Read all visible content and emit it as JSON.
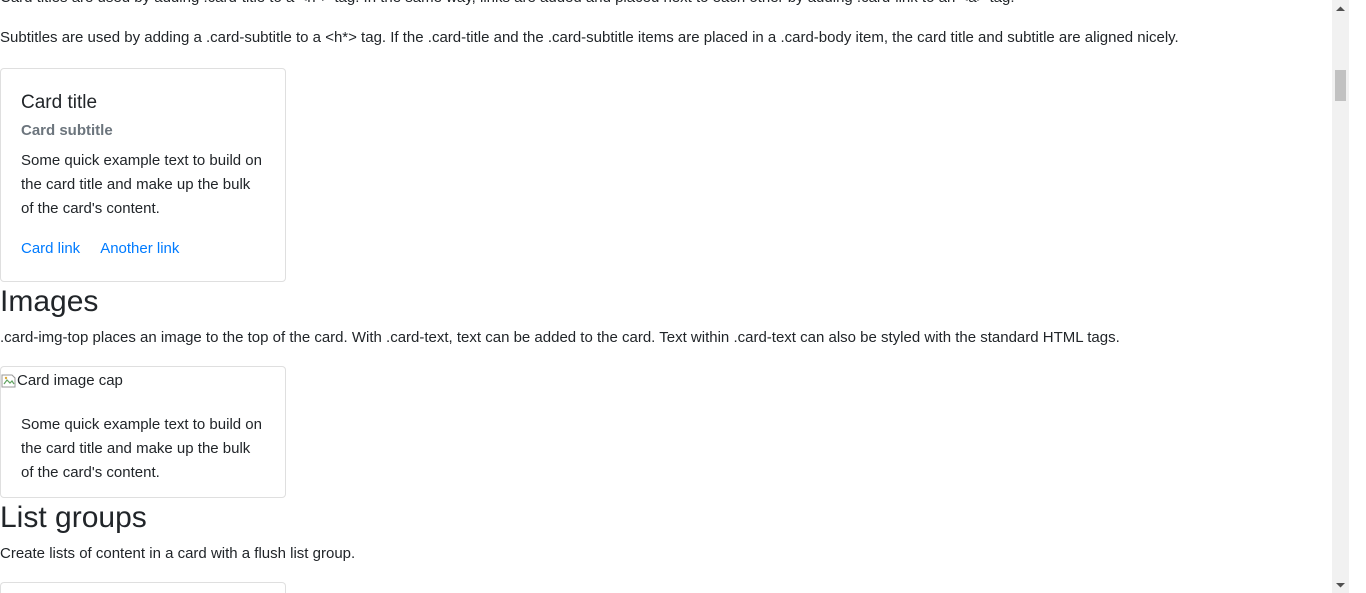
{
  "intro": {
    "titles_text": "Card titles are used by adding .card-title to a <h*> tag. In the same way, links are added and placed next to each other by adding .card-link to an <a> tag.",
    "subtitles_text": "Subtitles are used by adding a .card-subtitle to a <h*> tag. If the .card-title and the .card-subtitle items are placed in a .card-body item, the card title and subtitle are aligned nicely."
  },
  "title_card": {
    "title": "Card title",
    "subtitle": "Card subtitle",
    "text": "Some quick example text to build on the card title and make up the bulk of the card's content.",
    "links": [
      "Card link",
      "Another link"
    ]
  },
  "images_section": {
    "heading": "Images",
    "description": ".card-img-top places an image to the top of the card. With .card-text, text can be added to the card. Text within .card-text can also be styled with the standard HTML tags.",
    "image_alt": "Card image cap",
    "card_text": "Some quick example text to build on the card title and make up the bulk of the card's content."
  },
  "list_groups_section": {
    "heading": "List groups",
    "description": "Create lists of content in a card with a flush list group."
  },
  "colors": {
    "link": "#007bff",
    "muted": "#6c757d",
    "text": "#212529"
  }
}
